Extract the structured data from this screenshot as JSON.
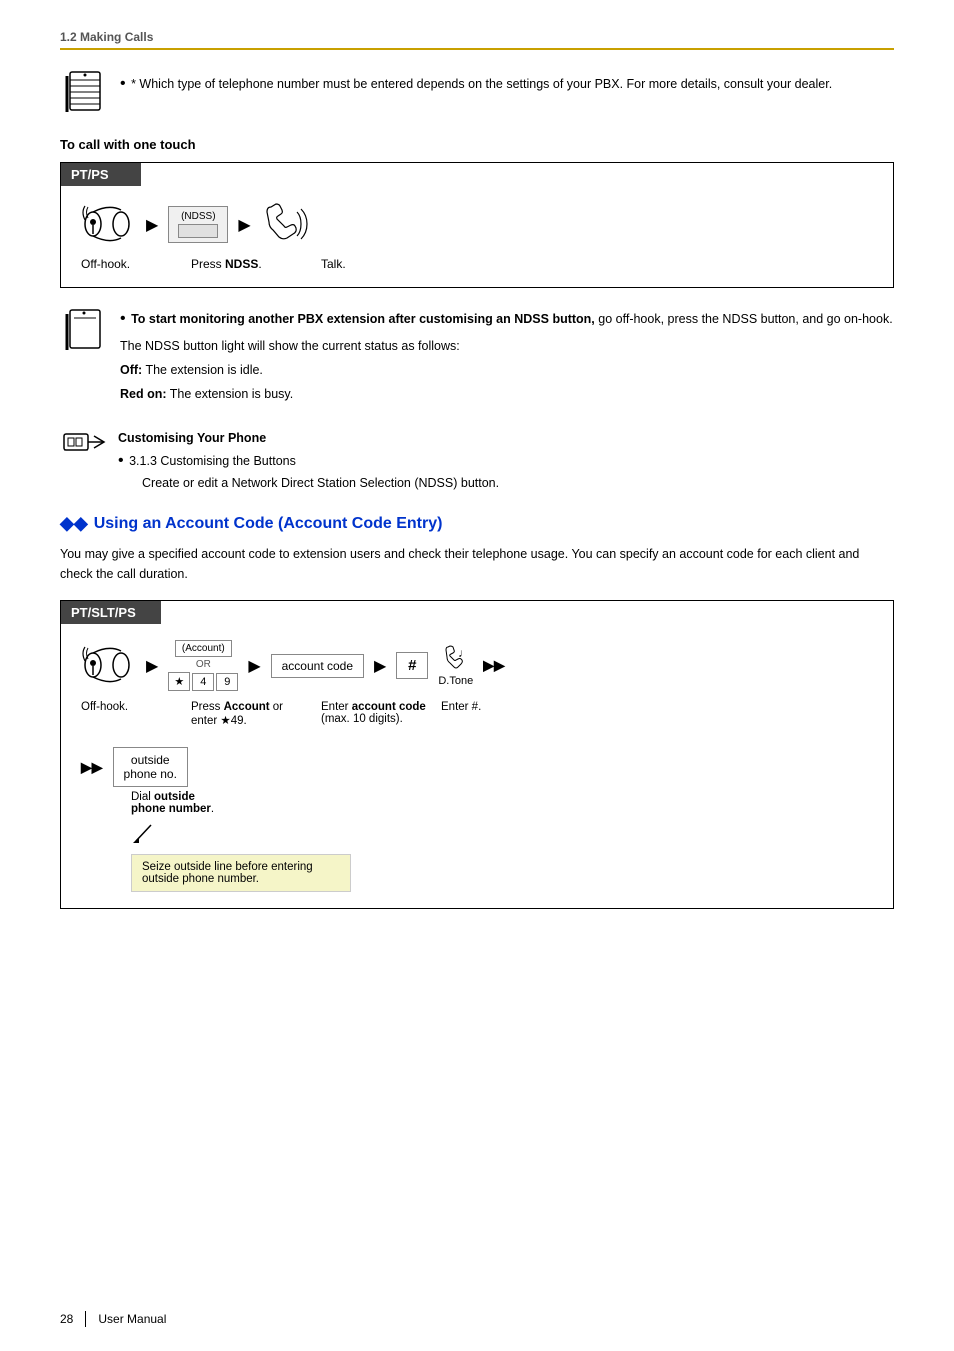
{
  "page": {
    "section": "1.2 Making Calls",
    "footer": {
      "page_number": "28",
      "separator": "|",
      "label": "User Manual"
    }
  },
  "note1": {
    "text": "* Which type of telephone number must be entered depends on the settings of your PBX. For more details, consult your dealer."
  },
  "one_touch": {
    "title": "To call with one touch",
    "device_label": "PT/PS",
    "steps": {
      "offhook": "Off-hook.",
      "press_ndss": "Press NDSS.",
      "talk": "Talk."
    },
    "ndss_label": "(NDSS)"
  },
  "monitoring_note": {
    "text_bold": "To start monitoring another PBX extension after customising an NDSS button,",
    "text_normal": " go off-hook, press the NDSS button, and go on-hook.",
    "text2": "The NDSS button light will show the current status as follows:",
    "off_label": "Off:",
    "off_text": "The extension is idle.",
    "red_label": "Red on:",
    "red_text": "The extension is busy."
  },
  "customising": {
    "title": "Customising Your Phone",
    "bullet": "3.1.3 Customising the Buttons",
    "sub": "Create or edit a Network Direct Station Selection (NDSS) button."
  },
  "account_code": {
    "section_title": "Using an Account Code (Account Code Entry)",
    "description": "You may give a specified account code to extension users and check their telephone usage. You can specify an account code for each client and check the call duration.",
    "device_label": "PT/SLT/PS",
    "steps": {
      "offhook": "Off-hook.",
      "press_account": "Press Account or enter ★49.",
      "enter_code": "Enter account code (max. 10 digits).",
      "enter_hash": "Enter #.",
      "dial_outside": "Dial outside phone number."
    },
    "account_btn_label": "(Account)",
    "or_label": "OR",
    "star_key": "★",
    "four_key": "4",
    "nine_key": "9",
    "account_code_box": "account code",
    "hash_key": "#",
    "dtone_label": "D.Tone",
    "outside_box_line1": "outside",
    "outside_box_line2": "phone no.",
    "callout_text": "Seize outside line before entering outside phone number."
  }
}
